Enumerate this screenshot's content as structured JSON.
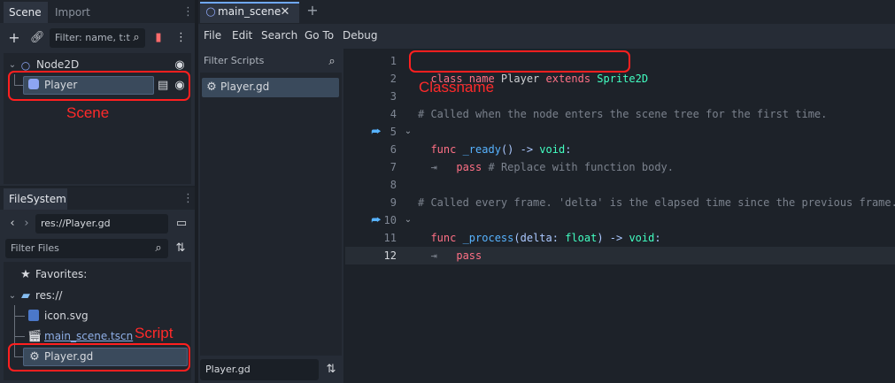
{
  "scene_dock": {
    "tabs": [
      "Scene",
      "Import"
    ],
    "filter_placeholder": "Filter: name, t:t",
    "tree": {
      "root": "Node2D",
      "child": "Player"
    }
  },
  "filesystem_dock": {
    "tab": "FileSystem",
    "path": "res://Player.gd",
    "filter_placeholder": "Filter Files",
    "items": {
      "favorites": "Favorites:",
      "res": "res://",
      "icon": "icon.svg",
      "main_scene": "main_scene.tscn",
      "player": "Player.gd"
    }
  },
  "editor": {
    "tab": "main_scene",
    "menu": [
      "File",
      "Edit",
      "Search",
      "Go To",
      "Debug"
    ],
    "filter_scripts": "Filter Scripts",
    "script_list": [
      "Player.gd"
    ],
    "bottom_label": "Player.gd",
    "line_numbers": [
      "1",
      "2",
      "3",
      "4",
      "5",
      "6",
      "7",
      "8",
      "9",
      "10",
      "11",
      "12"
    ]
  },
  "code": {
    "l1_kw1": "class_name",
    "l1_id": " Player ",
    "l1_kw2": "extends",
    "l1_ty": " Sprite2D",
    "l4": "# Called when the node enters the scene tree for the first time.",
    "l5_kw": "func",
    "l5_fn": " _ready",
    "l5_rest": "() -> ",
    "l5_ty": "void",
    "l5_end": ":",
    "l6_tab": "⇥   ",
    "l6_kw": "pass",
    "l6_cm": " # Replace with function body.",
    "l9": "# Called every frame. 'delta' is the elapsed time since the previous frame.",
    "l10_kw": "func",
    "l10_fn": " _process",
    "l10_a": "(delta: ",
    "l10_ty": "float",
    "l10_b": ") -> ",
    "l10_ty2": "void",
    "l10_end": ":",
    "l11_tab": "⇥   ",
    "l11_kw": "pass"
  },
  "annotations": {
    "scene": "Scene",
    "script": "Script",
    "classname": "Classname"
  },
  "colors": {
    "annotation_red": "#ff1f1f",
    "keyword": "#ff7085",
    "type": "#42ffc2",
    "function": "#57b3ff",
    "comment": "#7b828d"
  }
}
